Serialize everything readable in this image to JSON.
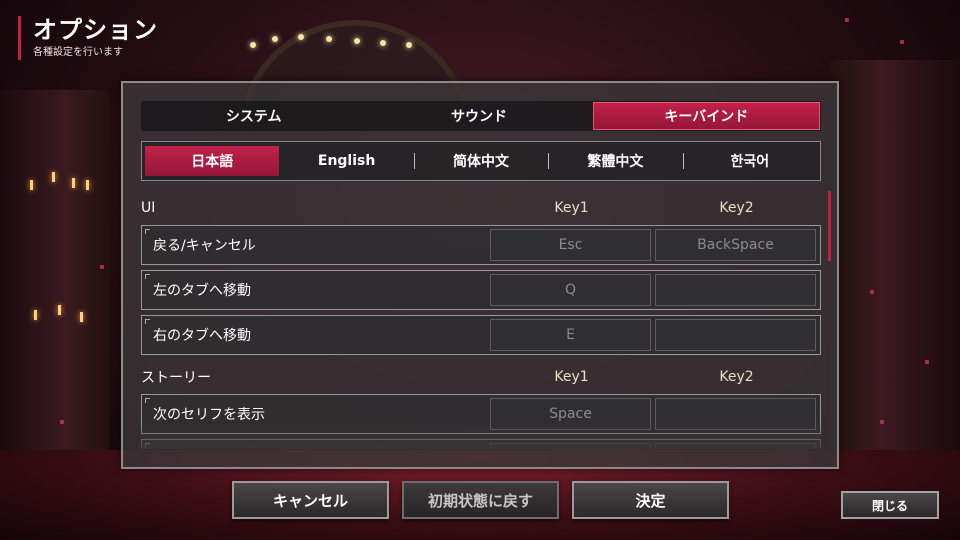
{
  "header": {
    "title": "オプション",
    "subtitle": "各種設定を行います"
  },
  "tabs": [
    {
      "label": "システム",
      "active": false
    },
    {
      "label": "サウンド",
      "active": false
    },
    {
      "label": "キーバインド",
      "active": true
    }
  ],
  "languages": [
    {
      "label": "日本語",
      "active": true
    },
    {
      "label": "English",
      "active": false
    },
    {
      "label": "简体中文",
      "active": false
    },
    {
      "label": "繁體中文",
      "active": false
    },
    {
      "label": "한국어",
      "active": false
    }
  ],
  "sections": {
    "ui": {
      "title": "UI",
      "key1_header": "Key1",
      "key2_header": "Key2",
      "rows": [
        {
          "label": "戻る/キャンセル",
          "key1": "Esc",
          "key2": "BackSpace"
        },
        {
          "label": "左のタブへ移動",
          "key1": "Q",
          "key2": ""
        },
        {
          "label": "右のタブへ移動",
          "key1": "E",
          "key2": ""
        }
      ]
    },
    "story": {
      "title": "ストーリー",
      "key1_header": "Key1",
      "key2_header": "Key2",
      "rows": [
        {
          "label": "次のセリフを表示",
          "key1": "Space",
          "key2": ""
        },
        {
          "label": "",
          "key1": "",
          "key2": ""
        }
      ]
    }
  },
  "buttons": {
    "cancel": "キャンセル",
    "reset": "初期状態に戻す",
    "confirm": "決定",
    "close": "閉じる"
  },
  "colors": {
    "accent": "#c21f47",
    "panel_border": "#8d8a8b",
    "key_text": "#8c8a8c"
  }
}
